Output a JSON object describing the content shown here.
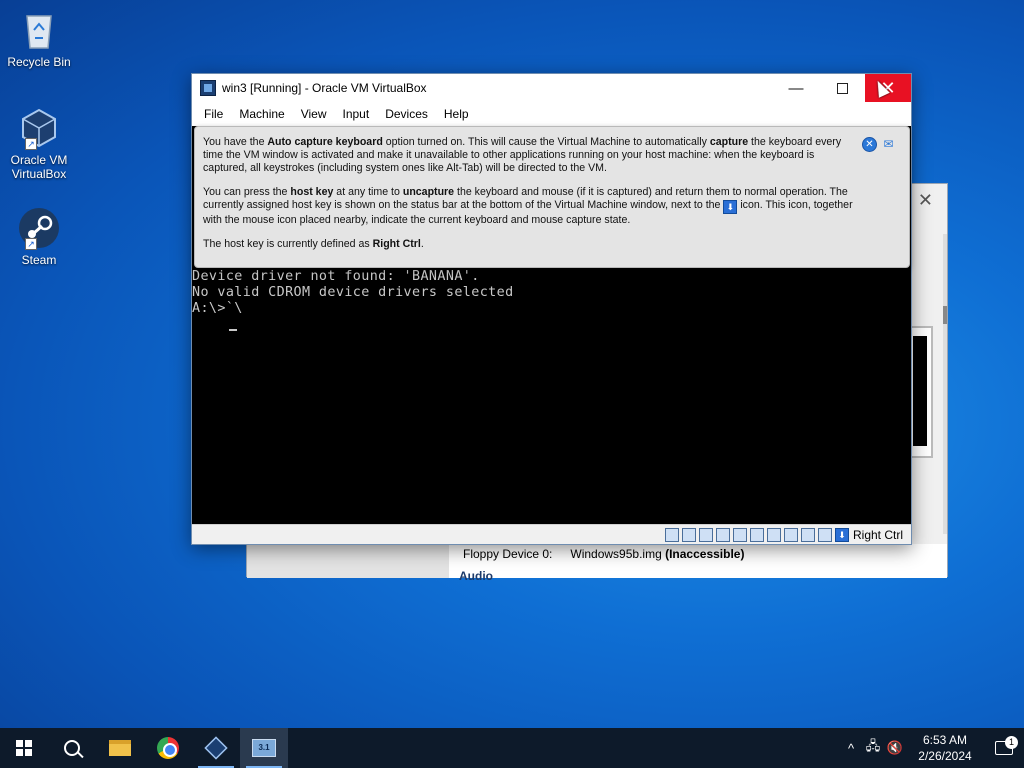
{
  "desktop": {
    "icons": [
      {
        "label": "Recycle Bin",
        "icon": "recycle-bin-icon"
      },
      {
        "label": "Oracle VM VirtualBox",
        "icon": "virtualbox-icon"
      },
      {
        "label": "Steam",
        "icon": "steam-icon"
      }
    ]
  },
  "bg_window": {
    "floppy_label": "Floppy Device 0:",
    "floppy_value": "Windows95b.img",
    "floppy_status": "(Inaccessible)",
    "audio_label": "Audio"
  },
  "vm_window": {
    "title": "win3 [Running] - Oracle VM VirtualBox",
    "menu": [
      "File",
      "Machine",
      "View",
      "Input",
      "Devices",
      "Help"
    ],
    "notice": {
      "p1_a": "You have the ",
      "p1_b": "Auto capture keyboard",
      "p1_c": " option turned on. This will cause the Virtual Machine to automatically ",
      "p1_d": "capture",
      "p1_e": " the keyboard every time the VM window is activated and make it unavailable to other applications running on your host machine: when the keyboard is captured, all keystrokes (including system ones like Alt-Tab) will be directed to the VM.",
      "p2_a": "You can press the ",
      "p2_b": "host key",
      "p2_c": " at any time to ",
      "p2_d": "uncapture",
      "p2_e": " the keyboard and mouse (if it is captured) and return them to normal operation. The currently assigned host key is shown on the status bar at the bottom of the Virtual Machine window, next to the ",
      "p2_f": " icon. This icon, together with the mouse icon placed nearby, indicate the current keyboard and mouse capture state.",
      "p3_a": "The host key is currently defined as ",
      "p3_b": "Right Ctrl",
      "p3_c": "."
    },
    "console": {
      "line1": "Device driver not found: 'BANANA'.",
      "line2": "No valid CDROM device drivers selected",
      "line3": "A:\\>`\\"
    },
    "status": {
      "host_key": "Right Ctrl"
    }
  },
  "taskbar": {
    "time": "6:53 AM",
    "date": "2/26/2024",
    "notification_count": "1"
  }
}
